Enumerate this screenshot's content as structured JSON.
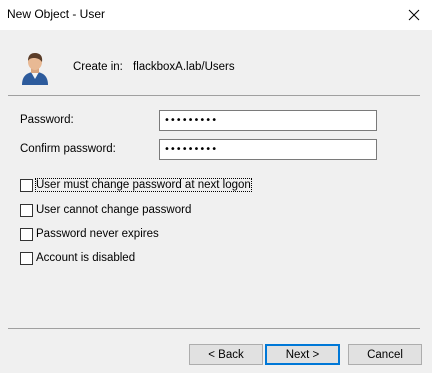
{
  "window": {
    "title": "New Object - User"
  },
  "header": {
    "create_in_label": "Create in:",
    "create_in_value": "flackboxA.lab/Users"
  },
  "fields": {
    "password_label": "Password:",
    "password_value": "•••••••••",
    "confirm_label": "Confirm password:",
    "confirm_value": "•••••••••"
  },
  "options": [
    {
      "label": "User must change password at next logon",
      "checked": false
    },
    {
      "label": "User cannot change password",
      "checked": false
    },
    {
      "label": "Password never expires",
      "checked": false
    },
    {
      "label": "Account is disabled",
      "checked": false
    }
  ],
  "buttons": {
    "back": "< Back",
    "next": "Next >",
    "cancel": "Cancel"
  },
  "icons": {
    "close": "close-icon",
    "user": "user-icon"
  }
}
